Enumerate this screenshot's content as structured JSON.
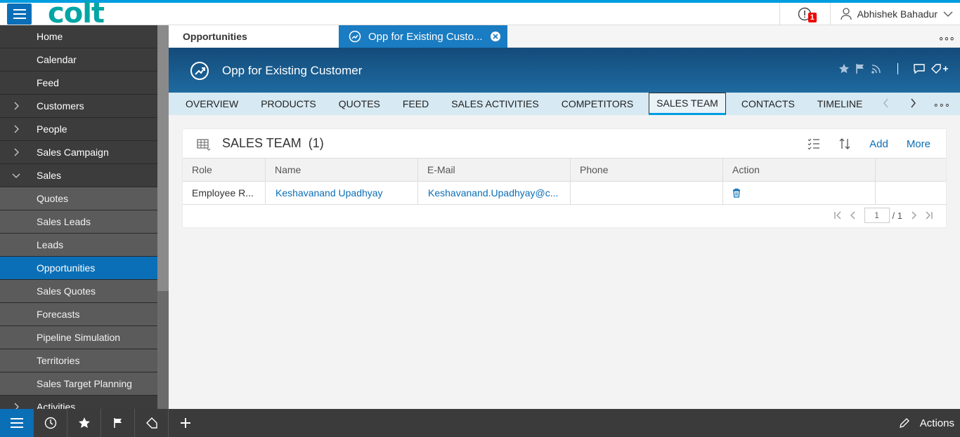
{
  "brand": {
    "logo_text": "colt"
  },
  "topbar": {
    "alert_count": "1",
    "user_name": "Abhishek Bahadur"
  },
  "sidebar": {
    "items": [
      {
        "label": "Home",
        "level": "top",
        "chevron": ""
      },
      {
        "label": "Calendar",
        "level": "top",
        "chevron": ""
      },
      {
        "label": "Feed",
        "level": "top",
        "chevron": ""
      },
      {
        "label": "Customers",
        "level": "top",
        "chevron": "right"
      },
      {
        "label": "People",
        "level": "top",
        "chevron": "right"
      },
      {
        "label": "Sales Campaign",
        "level": "top",
        "chevron": "right"
      },
      {
        "label": "Sales",
        "level": "top",
        "chevron": "down"
      },
      {
        "label": "Quotes",
        "level": "sub",
        "chevron": ""
      },
      {
        "label": "Sales Leads",
        "level": "sub",
        "chevron": ""
      },
      {
        "label": "Leads",
        "level": "sub",
        "chevron": ""
      },
      {
        "label": "Opportunities",
        "level": "sub",
        "chevron": "",
        "active": true
      },
      {
        "label": "Sales Quotes",
        "level": "sub",
        "chevron": ""
      },
      {
        "label": "Forecasts",
        "level": "sub",
        "chevron": ""
      },
      {
        "label": "Pipeline Simulation",
        "level": "sub",
        "chevron": ""
      },
      {
        "label": "Territories",
        "level": "sub",
        "chevron": ""
      },
      {
        "label": "Sales Target Planning",
        "level": "sub",
        "chevron": ""
      },
      {
        "label": "Activities",
        "level": "top",
        "chevron": "right"
      }
    ]
  },
  "tabs": {
    "list_tab": "Opportunities",
    "detail_tab": "Opp for Existing Custo..."
  },
  "header": {
    "title": "Opp for Existing Customer"
  },
  "subnav": {
    "items": [
      "OVERVIEW",
      "PRODUCTS",
      "QUOTES",
      "FEED",
      "SALES ACTIVITIES",
      "COMPETITORS",
      "SALES TEAM",
      "CONTACTS",
      "TIMELINE"
    ],
    "active": "SALES TEAM"
  },
  "card": {
    "title": "SALES TEAM",
    "count": "(1)",
    "add_label": "Add",
    "more_label": "More",
    "columns": [
      "Role",
      "Name",
      "E-Mail",
      "Phone",
      "Action"
    ],
    "rows": [
      {
        "role": "Employee R...",
        "name": "Keshavanand Upadhyay",
        "email": "Keshavanand.Upadhyay@c...",
        "phone": ""
      }
    ],
    "pager": {
      "page": "1",
      "total": "/ 1"
    }
  },
  "bottombar": {
    "actions_label": "Actions"
  },
  "colors": {
    "accent": "#0a6fb7",
    "header": "#1e6aa0",
    "sidebar": "#4d4d4d",
    "subnav": "#d7e9f2",
    "badge": "#ee0000",
    "logo": "#00a5a5"
  }
}
